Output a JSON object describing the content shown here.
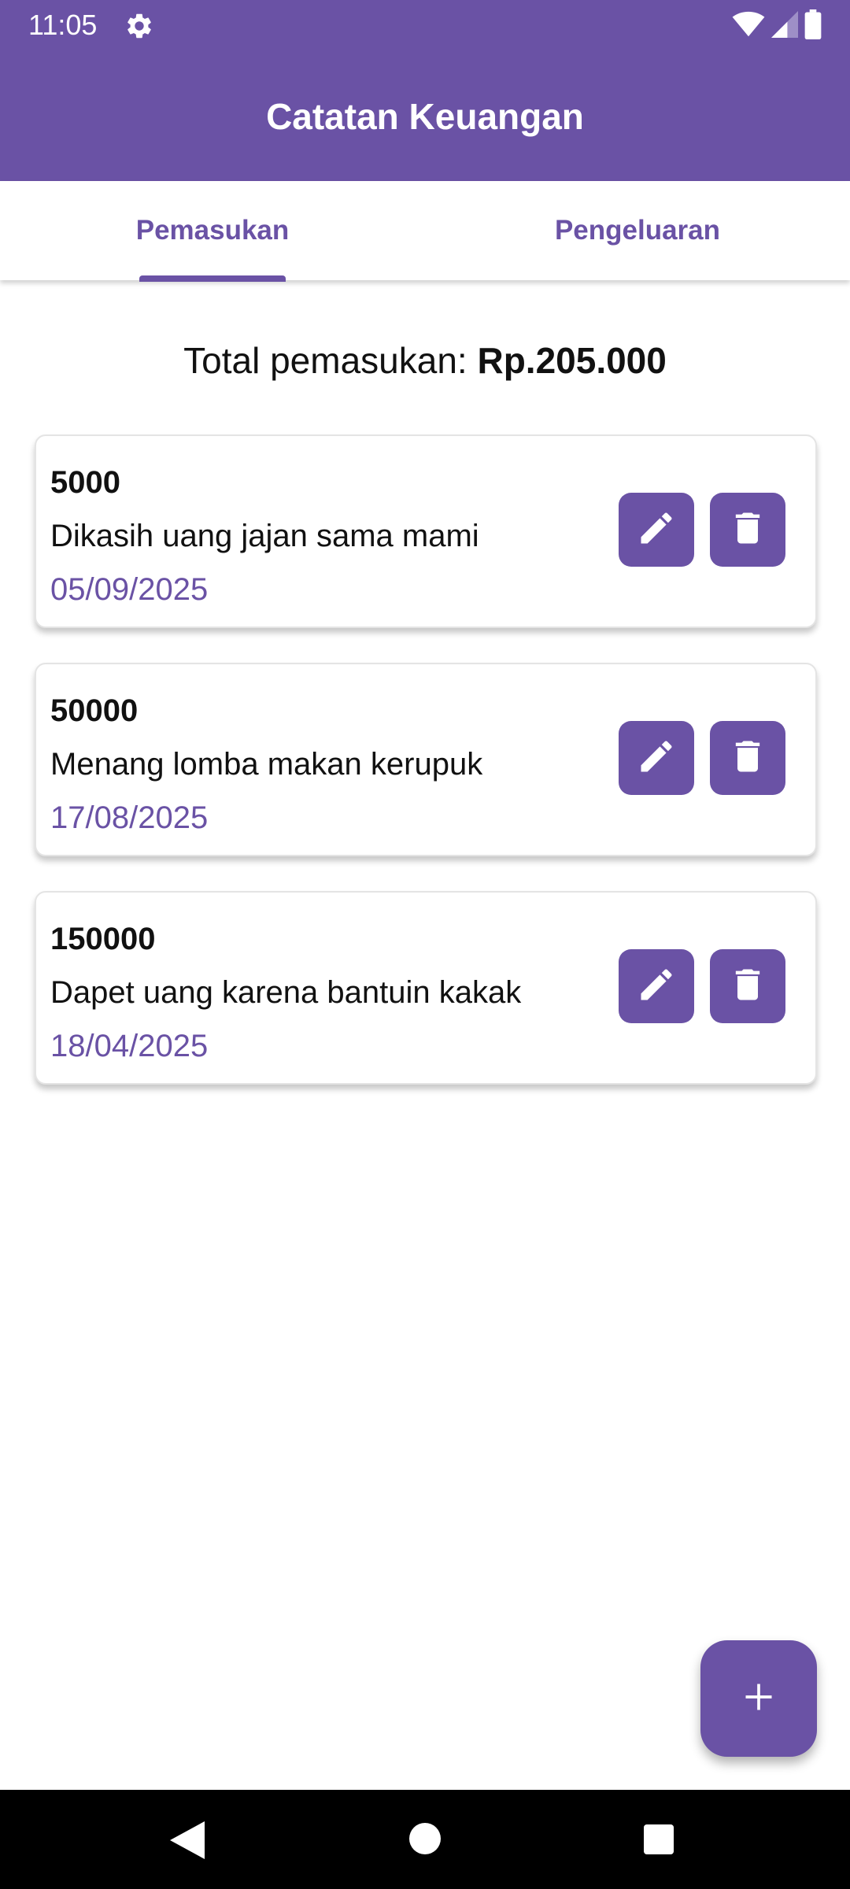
{
  "status_bar": {
    "time": "11:05",
    "icons": [
      "gear-icon",
      "wifi-icon",
      "signal-icon",
      "battery-icon"
    ]
  },
  "app_bar": {
    "title": "Catatan Keuangan"
  },
  "tabs": [
    {
      "label": "Pemasukan",
      "selected": true
    },
    {
      "label": "Pengeluaran",
      "selected": false
    }
  ],
  "summary": {
    "label": "Total pemasukan: ",
    "value": "Rp.205.000"
  },
  "entries": [
    {
      "amount": "5000",
      "description": "Dikasih uang jajan sama mami",
      "date": "05/09/2025"
    },
    {
      "amount": "50000",
      "description": "Menang lomba makan kerupuk",
      "date": "17/08/2025"
    },
    {
      "amount": "150000",
      "description": "Dapet uang karena bantuin kakak",
      "date": "18/04/2025"
    }
  ],
  "actions": {
    "edit_icon": "pencil-icon",
    "delete_icon": "trash-icon",
    "add_icon": "plus-icon"
  },
  "colors": {
    "primary": "#6A52A5",
    "text": "#111111",
    "date": "#6A52A5"
  }
}
